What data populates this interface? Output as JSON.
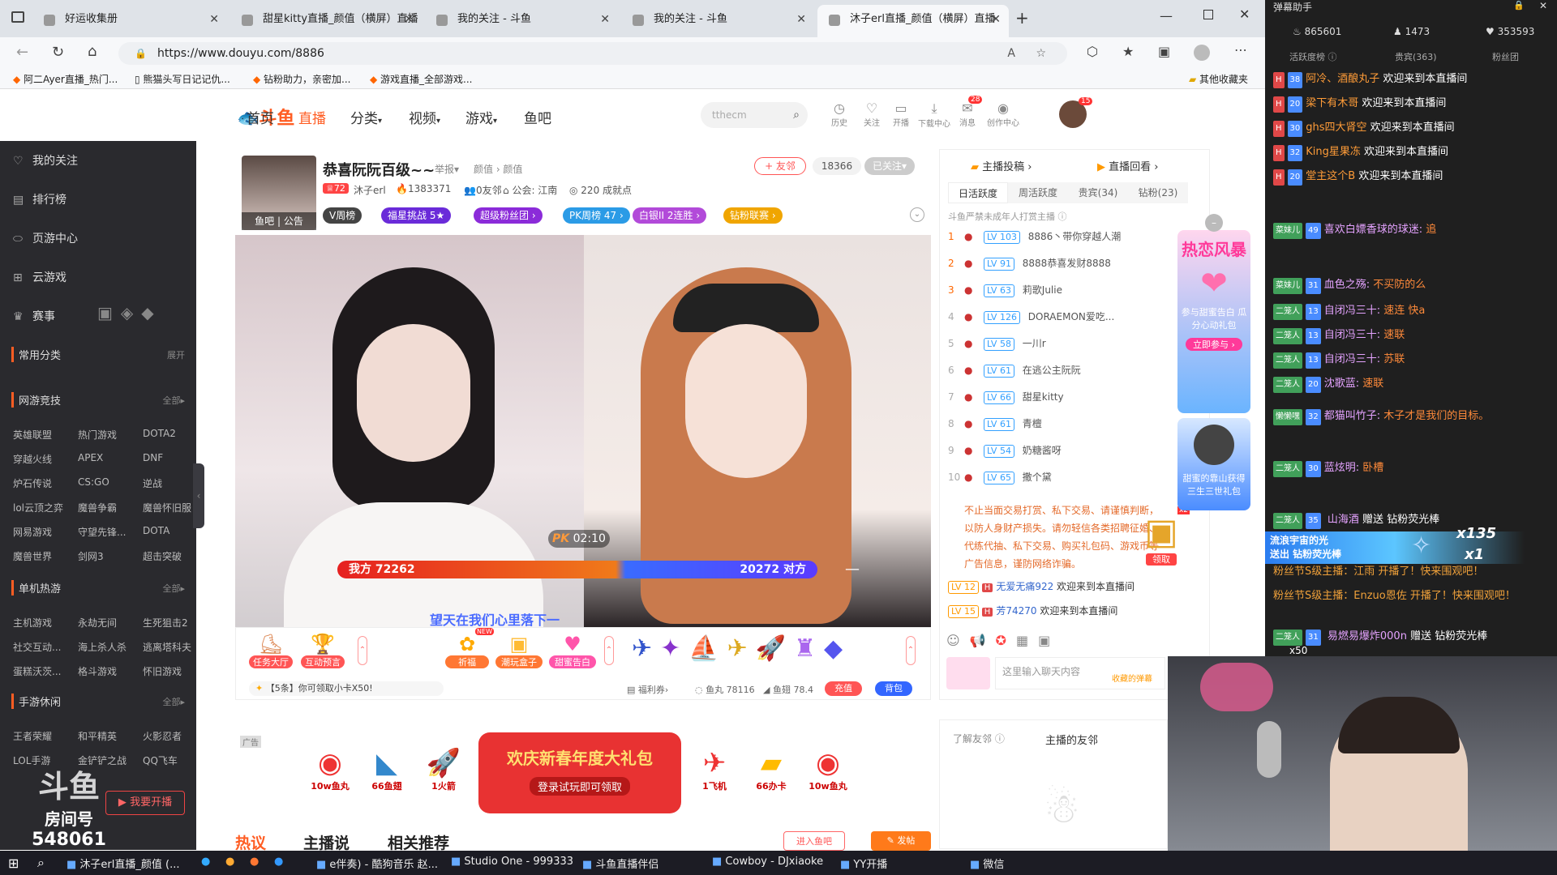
{
  "browser": {
    "tabs": [
      {
        "label": "好运收集册"
      },
      {
        "label": "甜星kitty直播_颜值（横屏）直播"
      },
      {
        "label": "我的关注 - 斗鱼"
      },
      {
        "label": "我的关注 - 斗鱼"
      },
      {
        "label": "沐子erl直播_颜值（横屏）直播"
      }
    ],
    "url": "https://www.douyu.com/8886",
    "bookmarks": [
      "阿二Ayer直播_热门...",
      "熊猫头写日记记仇...",
      "钻粉助力，亲密加...",
      "游戏直播_全部游戏..."
    ],
    "other_bookmarks": "其他收藏夹"
  },
  "site": {
    "logo": "斗鱼",
    "nav": [
      "首页",
      "直播",
      "分类",
      "视频",
      "游戏",
      "鱼吧"
    ],
    "search_placeholder": "tthecm",
    "icons": [
      {
        "label": "历史"
      },
      {
        "label": "关注"
      },
      {
        "label": "开播"
      },
      {
        "label": "下载中心"
      },
      {
        "label": "消息"
      },
      {
        "label": "创作中心"
      }
    ],
    "msg_badge": "28",
    "avatar_badge": "15"
  },
  "sidebar": {
    "main": [
      "我的关注",
      "排行榜",
      "页游中心",
      "云游戏",
      "赛事"
    ],
    "common": "常用分类",
    "common_more": "展开",
    "sections": [
      {
        "title": "网游竞技",
        "more": "全部",
        "items": [
          "英雄联盟",
          "热门游戏",
          "DOTA2",
          "穿越火线",
          "APEX",
          "DNF",
          "炉石传说",
          "CS:GO",
          "逆战",
          "lol云顶之弈",
          "魔兽争霸",
          "魔兽怀旧服",
          "网易游戏",
          "守望先锋...",
          "DOTA",
          "魔兽世界",
          "剑网3",
          "超击突破"
        ]
      },
      {
        "title": "单机热游",
        "more": "全部",
        "items": [
          "主机游戏",
          "永劫无间",
          "生死狙击2",
          "社交互动...",
          "海上杀人杀",
          "逃离塔科夫",
          "蛋糕沃茨...",
          "格斗游戏",
          "怀旧游戏"
        ]
      },
      {
        "title": "手游休闲",
        "more": "全部",
        "items": [
          "王者荣耀",
          "和平精英",
          "火影忍者",
          "LOL手游",
          "金铲铲之战",
          "QQ飞车"
        ]
      }
    ],
    "open_button": "我要开播",
    "room_label": "房间号",
    "room_id": "548061"
  },
  "stream": {
    "title": "恭喜阮阮百级~~",
    "report": "举报",
    "category": "颜值 › 颜值",
    "streamer": "沐子erl",
    "level": "72",
    "heat": "1383371",
    "friends": "0友邻",
    "guild": "公会: 江南",
    "achievements": "220 成就点",
    "friend_btn": "+ 友邻",
    "followers": "18366",
    "followed": "已关注",
    "tags": [
      "鱼吧",
      "公告"
    ],
    "pills": [
      "V周榜",
      "福星挑战 5★",
      "超级粉丝团 ›",
      "PK周榜 47 ›",
      "白银II 2连胜 ›",
      "钻粉联赛 ›"
    ],
    "pk_time": "02:10",
    "pk_label": "PK",
    "our_score": "我方 72262",
    "their_score": "20272 对方",
    "subtitle": "望天在我们心里落下一"
  },
  "gifts": {
    "left": [
      "任务大厅",
      "互动预言"
    ],
    "mid": [
      "祈福",
      "潮玩盒子",
      "甜蜜告白"
    ],
    "new_badge": "NEW",
    "tip": "【5条】你可领取小卡X50!",
    "welfare": "福利券›",
    "fish_balls": "鱼丸 78116",
    "fish_fins": "鱼翅 78.4",
    "recharge": "充值",
    "bag": "背包"
  },
  "banner": {
    "ad": "广告",
    "title": "欢庆新春年度大礼包",
    "sub": "登录试玩即可领取",
    "items": [
      "10w鱼丸",
      "66鱼翅",
      "1火箭",
      "1飞机",
      "66办卡",
      "10w鱼丸"
    ]
  },
  "bottom_tabs": [
    "热议",
    "主播说",
    "相关推荐"
  ],
  "bottom_btns": [
    "进入鱼吧",
    "发帖"
  ],
  "rank": {
    "top_links": [
      "主播投稿 ›",
      "直播回看 ›"
    ],
    "tabs": [
      "日活跃度",
      "周活跃度",
      "贵宾(34)",
      "钻粉(23)"
    ],
    "notice": "斗鱼严禁未成年人打赏主播",
    "rows": [
      {
        "n": "1",
        "lv": "LV 103",
        "name": "8886丶带你穿越人潮"
      },
      {
        "n": "2",
        "lv": "LV 91",
        "name": "8888恭喜发财8888"
      },
      {
        "n": "3",
        "lv": "LV 63",
        "name": "莉歌Julie"
      },
      {
        "n": "4",
        "lv": "LV 126",
        "name": "DORAEMON爱吃..."
      },
      {
        "n": "5",
        "lv": "LV 58",
        "name": "一川r"
      },
      {
        "n": "6",
        "lv": "LV 61",
        "name": "在逃公主阮阮"
      },
      {
        "n": "7",
        "lv": "LV 66",
        "name": "甜星kitty"
      },
      {
        "n": "8",
        "lv": "LV 61",
        "name": "青檀"
      },
      {
        "n": "9",
        "lv": "LV 54",
        "name": "奶糖酱呀"
      },
      {
        "n": "10",
        "lv": "LV 65",
        "name": "撒个黛"
      }
    ],
    "warn": "不止当面交易打赏、私下交易、请谨慎判断，以防人身财产损失。请勿轻信各类招聘征婚、代练代抽、私下交易、购买礼包码、游戏币等广告信息，谨防网络诈骗。",
    "welcomes": [
      {
        "lv": "LV 12",
        "name": "无爱无痛922",
        "msg": "欢迎来到本直播间"
      },
      {
        "lv": "LV 15",
        "name": "芳74270",
        "msg": "欢迎来到本直播间"
      }
    ],
    "claim": "领取",
    "chat_placeholder": "这里输入聊天内容",
    "sticker": "收藏的弹幕",
    "friend_tabs": [
      "了解友邻",
      "主播的友邻"
    ],
    "promo_title": "热恋风暴",
    "promo_sub": "参与甜蜜告白 瓜分心动礼包",
    "promo_btn": "立即参与 ›",
    "promo2": "甜蜜的靠山获得 三生三世礼包",
    "x2": "x2"
  },
  "danmaku": {
    "title": "弹幕助手",
    "stats": [
      "865601",
      "1473",
      "353593"
    ],
    "tabs": [
      "活跃度榜",
      "贵宾(363)",
      "粉丝团"
    ],
    "rows": [
      {
        "lv": "38",
        "name": "阿冷、酒酿丸子",
        "msg": "欢迎来到本直播间"
      },
      {
        "lv": "20",
        "name": "梁下有木哥",
        "msg": "欢迎来到本直播间"
      },
      {
        "lv": "30",
        "name": "ghs四大肾空",
        "msg": "欢迎来到本直播间"
      },
      {
        "lv": "32",
        "name": "King星果冻",
        "msg": "欢迎来到本直播间"
      },
      {
        "lv": "20",
        "name": "堂主这个B",
        "msg": "欢迎来到本直播间"
      }
    ],
    "chat": [
      {
        "fan": "菜妹儿",
        "lv": "49",
        "name": "喜欢白嫖香球的球迷:",
        "msg": "追"
      },
      {
        "fan": "菜妹儿",
        "lv": "31",
        "name": "血色之殇:",
        "msg": "不买防的么"
      },
      {
        "fan": "二笼人",
        "lv": "13",
        "name": "自闭冯三十:",
        "msg": "速连 快a"
      },
      {
        "fan": "二笼人",
        "lv": "13",
        "name": "自闭冯三十:",
        "msg": "速联"
      },
      {
        "fan": "二笼人",
        "lv": "13",
        "name": "自闭冯三十:",
        "msg": "苏联"
      },
      {
        "fan": "二笼人",
        "lv": "20",
        "name": "沈歌蓝:",
        "msg": "速联"
      },
      {
        "fan": "懒懒嘿",
        "lv": "32",
        "name": "都猫叫竹子:",
        "msg": "木子才是我们的目标。"
      },
      {
        "fan": "二笼人",
        "lv": "30",
        "name": "蓝炫明:",
        "msg": "卧槽"
      }
    ],
    "gift1": {
      "lv": "35",
      "name": "山海酒",
      "action": "赠送",
      "gift": "钻粉荧光棒",
      "count": "x135"
    },
    "banner_user": "流浪宇宙的光",
    "banner_action": "送出 钻粉荧光棒",
    "banner_count": "x1",
    "sys1": "粉丝节S级主播：江雨 开播了！快来围观吧！",
    "sys2": "粉丝节S级主播：Enzuo恩佐 开播了！快来围观吧！",
    "gift2": {
      "lv": "31",
      "name": "易燃易爆炸000n",
      "action": "赠送",
      "gift": "钻粉荧光棒",
      "count": "x50"
    }
  },
  "overlay": {
    "logo": "斗鱼",
    "room_label": "房间号",
    "room_id": "548061"
  },
  "taskbar": {
    "items": [
      "沐子erl直播_颜值 (...",
      "e伴奏) - 酷狗音乐 赵...",
      "Studio One - 999333",
      "斗鱼直播伴侣",
      "Cowboy - DJxiaoke",
      "YY开播",
      "微信"
    ]
  },
  "colors": {
    "brand": "#ff5d23",
    "danmaku_bg": "#1f1f1f",
    "sidebar_bg": "#2a2a2e"
  }
}
